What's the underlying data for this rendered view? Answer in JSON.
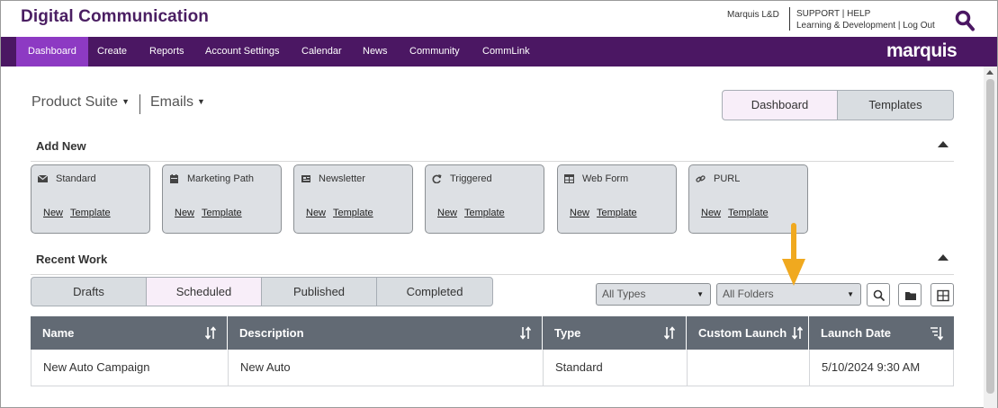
{
  "header": {
    "app_title": "Digital Communication",
    "user_label": "Marquis L&D",
    "support": "SUPPORT",
    "help": "HELP",
    "link_sep": "|",
    "learning": "Learning & Development",
    "logout": "Log Out",
    "search_icon": "search-icon"
  },
  "nav": {
    "items": [
      "Dashboard",
      "Create",
      "Reports",
      "Account Settings",
      "Calendar",
      "News",
      "Community",
      "CommLink"
    ],
    "active": "Dashboard",
    "brand": "marquis"
  },
  "selectors": {
    "product": "Product Suite",
    "channel": "Emails"
  },
  "view_toggle": {
    "dashboard": "Dashboard",
    "templates": "Templates",
    "active": "Dashboard"
  },
  "add_new": {
    "title": "Add New",
    "cards": [
      {
        "label": "Standard",
        "icon": "envelope-icon",
        "new": "New",
        "template": "Template"
      },
      {
        "label": "Marketing Path",
        "icon": "calendar-icon",
        "new": "New",
        "template": "Template"
      },
      {
        "label": "Newsletter",
        "icon": "newspaper-icon",
        "new": "New",
        "template": "Template"
      },
      {
        "label": "Triggered",
        "icon": "refresh-icon",
        "new": "New",
        "template": "Template"
      },
      {
        "label": "Web Form",
        "icon": "table-icon",
        "new": "New",
        "template": "Template"
      },
      {
        "label": "PURL",
        "icon": "link-icon",
        "new": "New",
        "template": "Template"
      }
    ]
  },
  "recent_work": {
    "title": "Recent Work",
    "tabs": [
      "Drafts",
      "Scheduled",
      "Published",
      "Completed"
    ],
    "active_tab": "Scheduled",
    "type_filter": "All Types",
    "folder_filter": "All Folders",
    "columns": [
      "Name",
      "Description",
      "Type",
      "Custom Launch",
      "Launch Date"
    ],
    "rows": [
      {
        "name": "New Auto Campaign",
        "description": "New Auto",
        "type": "Standard",
        "custom_launch": "",
        "launch_date": "5/10/2024 9:30 AM"
      }
    ]
  },
  "colors": {
    "nav_bg": "#4b1763",
    "nav_active": "#8d3ac3",
    "title": "#4a1e62",
    "grid_header": "#626a74",
    "annotation_arrow": "#f0a91f"
  }
}
